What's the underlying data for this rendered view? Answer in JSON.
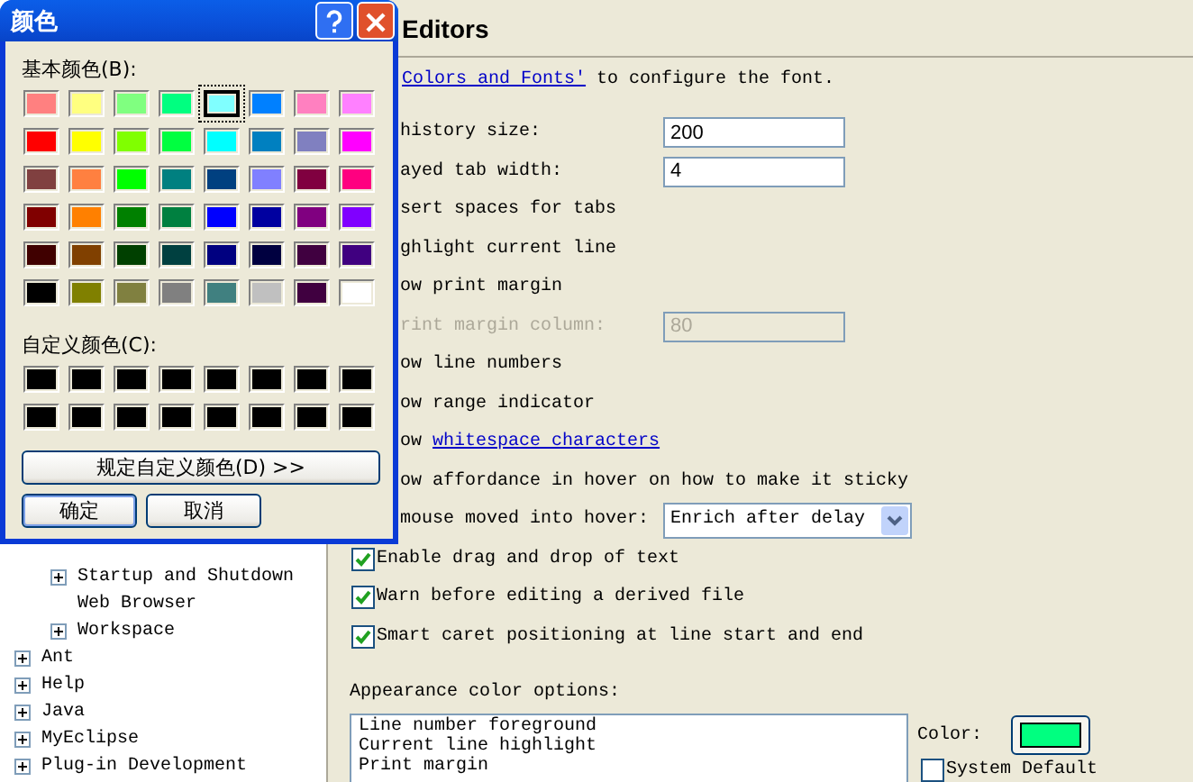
{
  "tree": {
    "items": [
      {
        "children": [
          {
            "label": "Startup and Shutdown",
            "expandable": true
          },
          {
            "label": "Web Browser",
            "expandable": false
          },
          {
            "label": "Workspace",
            "expandable": true
          }
        ]
      },
      {
        "label": "Ant",
        "expandable": true
      },
      {
        "label": "Help",
        "expandable": true
      },
      {
        "label": "Java",
        "expandable": true
      },
      {
        "label": "MyEclipse",
        "expandable": true
      },
      {
        "label": "Plug-in Development",
        "expandable": true
      }
    ]
  },
  "page": {
    "title": "Editors",
    "intro": {
      "link": "Colors and Fonts'",
      "text": "to configure the font."
    },
    "rows": [
      {
        "kind": "field",
        "label": "history size:",
        "value": "200",
        "disabled": false
      },
      {
        "kind": "field",
        "label": "ayed tab width:",
        "value": "4",
        "disabled": false
      },
      {
        "kind": "text",
        "label": "sert spaces for tabs"
      },
      {
        "kind": "text",
        "label": "ghlight current line"
      },
      {
        "kind": "text",
        "label": "ow print margin"
      },
      {
        "kind": "field",
        "label": "rint margin column:",
        "value": "80",
        "disabled": true
      },
      {
        "kind": "text",
        "label": "ow line numbers"
      },
      {
        "kind": "text",
        "label": "ow range indicator"
      },
      {
        "kind": "linktext",
        "label": "ow",
        "link": "whitespace characters"
      },
      {
        "kind": "text",
        "label": "ow affordance in hover on how to make it sticky"
      },
      {
        "kind": "combo",
        "label": "mouse moved into hover:",
        "value": "Enrich after delay"
      },
      {
        "kind": "checkbox",
        "label": "Enable drag and drop of text",
        "checked": true
      },
      {
        "kind": "checkbox",
        "label": "Warn before editing a derived file",
        "checked": true
      },
      {
        "kind": "checkbox",
        "label": "Smart caret positioning at line start and end",
        "checked": true
      }
    ],
    "appearance": {
      "label": "Appearance color options:",
      "items": [
        "Line number foreground",
        "Current line highlight",
        "Print margin"
      ],
      "color_label": "Color:",
      "color": "#00ff80",
      "system_default": {
        "label": "System Default",
        "checked": false
      }
    }
  },
  "dialog": {
    "title": "颜色",
    "basic_label": "基本颜色(B):",
    "basic_colors": [
      {
        "color": "#ff8080",
        "selected": false
      },
      {
        "color": "#ffff80",
        "selected": false
      },
      {
        "color": "#80ff80",
        "selected": false
      },
      {
        "color": "#00ff80",
        "selected": false
      },
      {
        "color": "#80ffff",
        "selected": true
      },
      {
        "color": "#0080ff",
        "selected": false
      },
      {
        "color": "#ff80c0",
        "selected": false
      },
      {
        "color": "#ff80ff",
        "selected": false
      },
      {
        "color": "#ff0000",
        "selected": false
      },
      {
        "color": "#ffff00",
        "selected": false
      },
      {
        "color": "#80ff00",
        "selected": false
      },
      {
        "color": "#00ff40",
        "selected": false
      },
      {
        "color": "#00ffff",
        "selected": false
      },
      {
        "color": "#0080c0",
        "selected": false
      },
      {
        "color": "#8080c0",
        "selected": false
      },
      {
        "color": "#ff00ff",
        "selected": false
      },
      {
        "color": "#804040",
        "selected": false
      },
      {
        "color": "#ff8040",
        "selected": false
      },
      {
        "color": "#00ff00",
        "selected": false
      },
      {
        "color": "#008080",
        "selected": false
      },
      {
        "color": "#004080",
        "selected": false
      },
      {
        "color": "#8080ff",
        "selected": false
      },
      {
        "color": "#800040",
        "selected": false
      },
      {
        "color": "#ff0080",
        "selected": false
      },
      {
        "color": "#800000",
        "selected": false
      },
      {
        "color": "#ff8000",
        "selected": false
      },
      {
        "color": "#008000",
        "selected": false
      },
      {
        "color": "#008040",
        "selected": false
      },
      {
        "color": "#0000ff",
        "selected": false
      },
      {
        "color": "#0000a0",
        "selected": false
      },
      {
        "color": "#800080",
        "selected": false
      },
      {
        "color": "#8000ff",
        "selected": false
      },
      {
        "color": "#400000",
        "selected": false
      },
      {
        "color": "#804000",
        "selected": false
      },
      {
        "color": "#004000",
        "selected": false
      },
      {
        "color": "#004040",
        "selected": false
      },
      {
        "color": "#000080",
        "selected": false
      },
      {
        "color": "#000040",
        "selected": false
      },
      {
        "color": "#400040",
        "selected": false
      },
      {
        "color": "#400080",
        "selected": false
      },
      {
        "color": "#000000",
        "selected": false
      },
      {
        "color": "#808000",
        "selected": false
      },
      {
        "color": "#808040",
        "selected": false
      },
      {
        "color": "#808080",
        "selected": false
      },
      {
        "color": "#408080",
        "selected": false
      },
      {
        "color": "#c0c0c0",
        "selected": false
      },
      {
        "color": "#400040",
        "selected": false
      },
      {
        "color": "#ffffff",
        "selected": false
      }
    ],
    "custom_label": "自定义颜色(C):",
    "custom_colors": [
      {
        "color": "#000000"
      },
      {
        "color": "#000000"
      },
      {
        "color": "#000000"
      },
      {
        "color": "#000000"
      },
      {
        "color": "#000000"
      },
      {
        "color": "#000000"
      },
      {
        "color": "#000000"
      },
      {
        "color": "#000000"
      },
      {
        "color": "#000000"
      },
      {
        "color": "#000000"
      },
      {
        "color": "#000000"
      },
      {
        "color": "#000000"
      },
      {
        "color": "#000000"
      },
      {
        "color": "#000000"
      },
      {
        "color": "#000000"
      },
      {
        "color": "#000000"
      }
    ],
    "define_button": "规定自定义颜色(D) >>",
    "buttons": [
      {
        "label": "确定",
        "default": true
      },
      {
        "label": "取消",
        "default": false
      }
    ]
  }
}
